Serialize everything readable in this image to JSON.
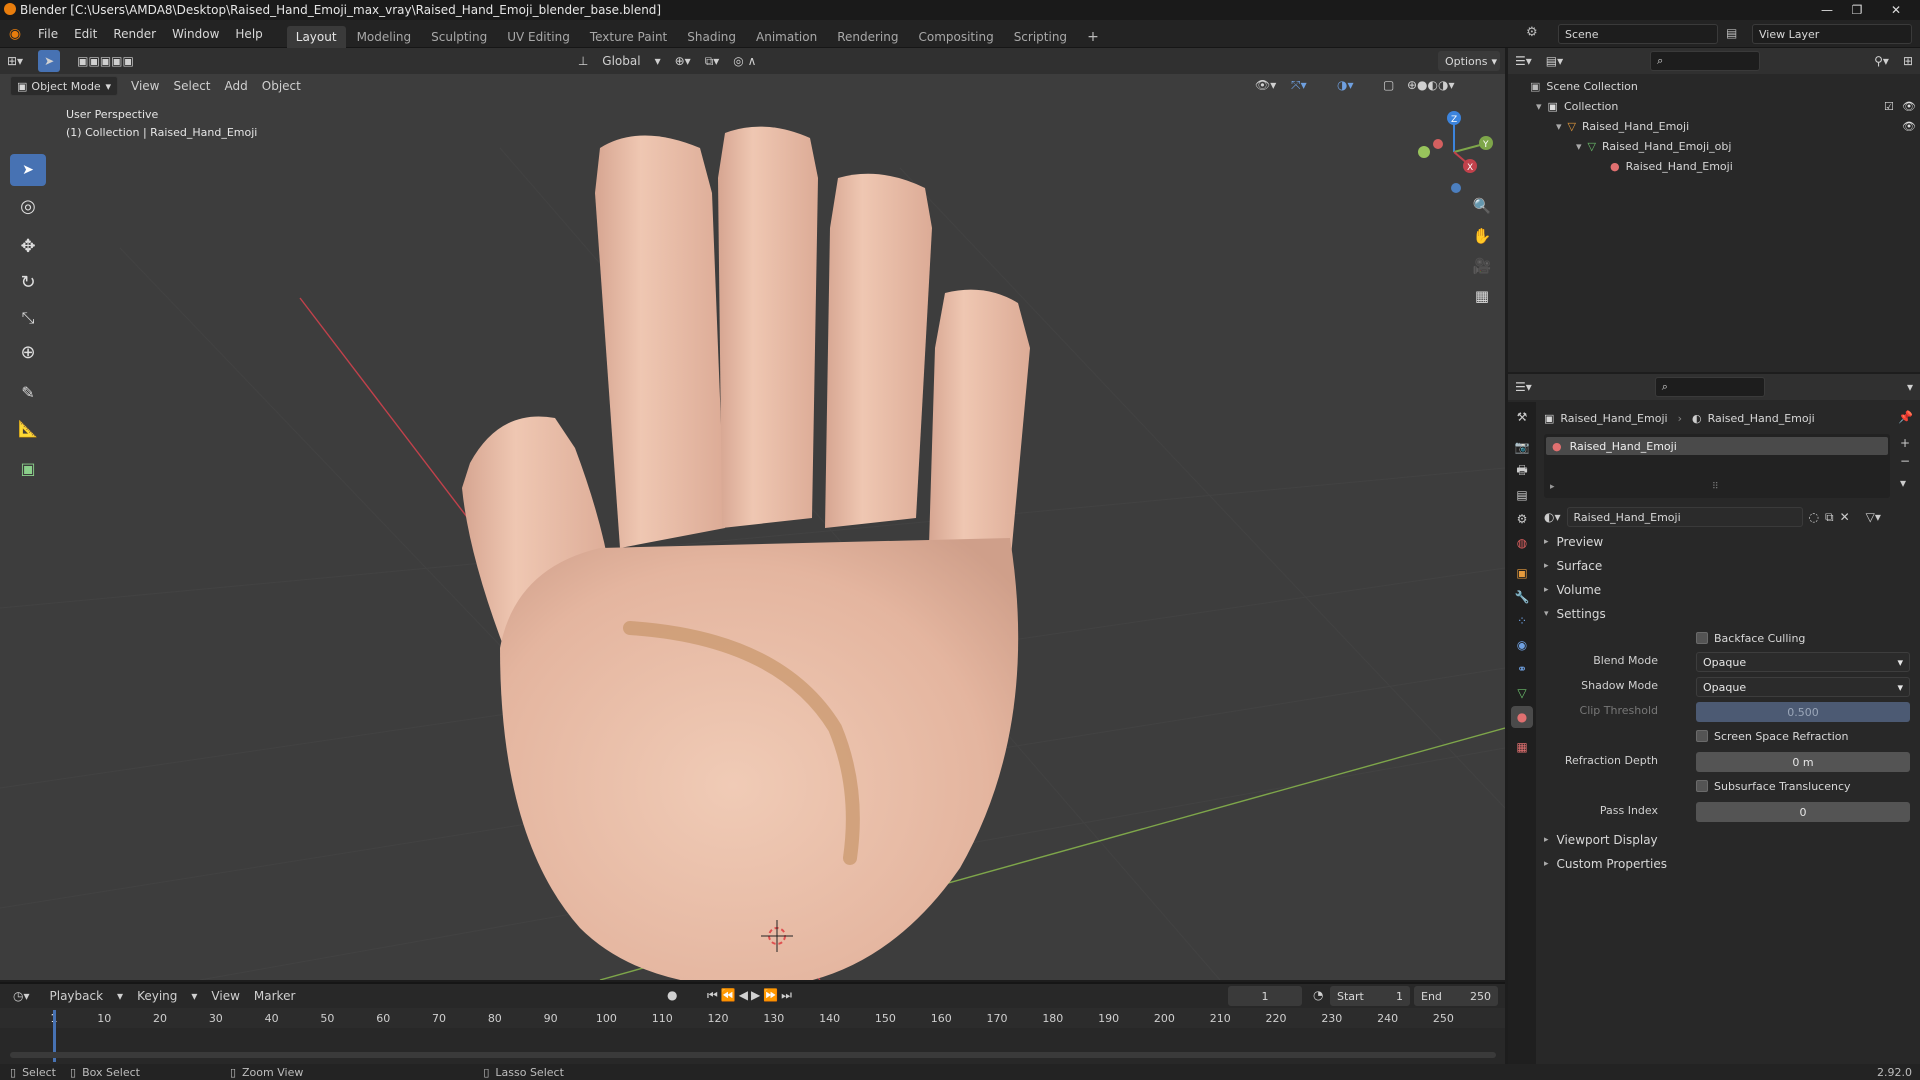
{
  "window": {
    "title": "Blender [C:\\Users\\AMDA8\\Desktop\\Raised_Hand_Emoji_max_vray\\Raised_Hand_Emoji_blender_base.blend]"
  },
  "menu": {
    "items": [
      "File",
      "Edit",
      "Render",
      "Window",
      "Help"
    ],
    "workspaces": [
      "Layout",
      "Modeling",
      "Sculpting",
      "UV Editing",
      "Texture Paint",
      "Shading",
      "Animation",
      "Rendering",
      "Compositing",
      "Scripting"
    ],
    "active_workspace": "Layout",
    "scene_label": "Scene",
    "view_layer_label": "View Layer"
  },
  "viewport": {
    "mode": "Object Mode",
    "menus": [
      "View",
      "Select",
      "Add",
      "Object"
    ],
    "orientation": "Global",
    "options_label": "Options",
    "perspective_label": "User Perspective",
    "collection_label": "(1) Collection | Raised_Hand_Emoji",
    "gizmo_axes": [
      "X",
      "Y",
      "Z"
    ]
  },
  "outliner": {
    "rows": [
      {
        "label": "Scene Collection"
      },
      {
        "label": "Collection"
      },
      {
        "label": "Raised_Hand_Emoji"
      },
      {
        "label": "Raised_Hand_Emoji_obj"
      },
      {
        "label": "Raised_Hand_Emoji"
      }
    ]
  },
  "properties": {
    "breadcrumb": [
      "Raised_Hand_Emoji",
      "Raised_Hand_Emoji"
    ],
    "slot_name": "Raised_Hand_Emoji",
    "material_name": "Raised_Hand_Emoji",
    "panels": {
      "preview": "Preview",
      "surface": "Surface",
      "volume": "Volume",
      "settings": "Settings",
      "viewport_display": "Viewport Display",
      "custom_properties": "Custom Properties"
    },
    "settings": {
      "backface_culling": "Backface Culling",
      "blend_mode_label": "Blend Mode",
      "blend_mode_value": "Opaque",
      "shadow_mode_label": "Shadow Mode",
      "shadow_mode_value": "Opaque",
      "clip_threshold_label": "Clip Threshold",
      "clip_threshold_value": "0.500",
      "screen_space_refraction": "Screen Space Refraction",
      "refraction_depth_label": "Refraction Depth",
      "refraction_depth_value": "0 m",
      "subsurface_translucency": "Subsurface Translucency",
      "pass_index_label": "Pass Index",
      "pass_index_value": "0"
    }
  },
  "timeline": {
    "menus": [
      "Playback",
      "Keying",
      "View",
      "Marker"
    ],
    "current_frame": "1",
    "start_label": "Start",
    "start_value": "1",
    "end_label": "End",
    "end_value": "250",
    "ticks": [
      "1",
      "10",
      "20",
      "30",
      "40",
      "50",
      "60",
      "70",
      "80",
      "90",
      "100",
      "110",
      "120",
      "130",
      "140",
      "150",
      "160",
      "170",
      "180",
      "190",
      "200",
      "210",
      "220",
      "230",
      "240",
      "250"
    ]
  },
  "statusbar": {
    "select": "Select",
    "box_select": "Box Select",
    "zoom_view": "Zoom View",
    "lasso_select": "Lasso Select",
    "version": "2.92.0"
  },
  "colors": {
    "accent": "#4772b3",
    "skin": "#e8c0ab",
    "x_axis": "#c1414b",
    "y_axis": "#7ea64a",
    "z_axis": "#3c84dd"
  }
}
